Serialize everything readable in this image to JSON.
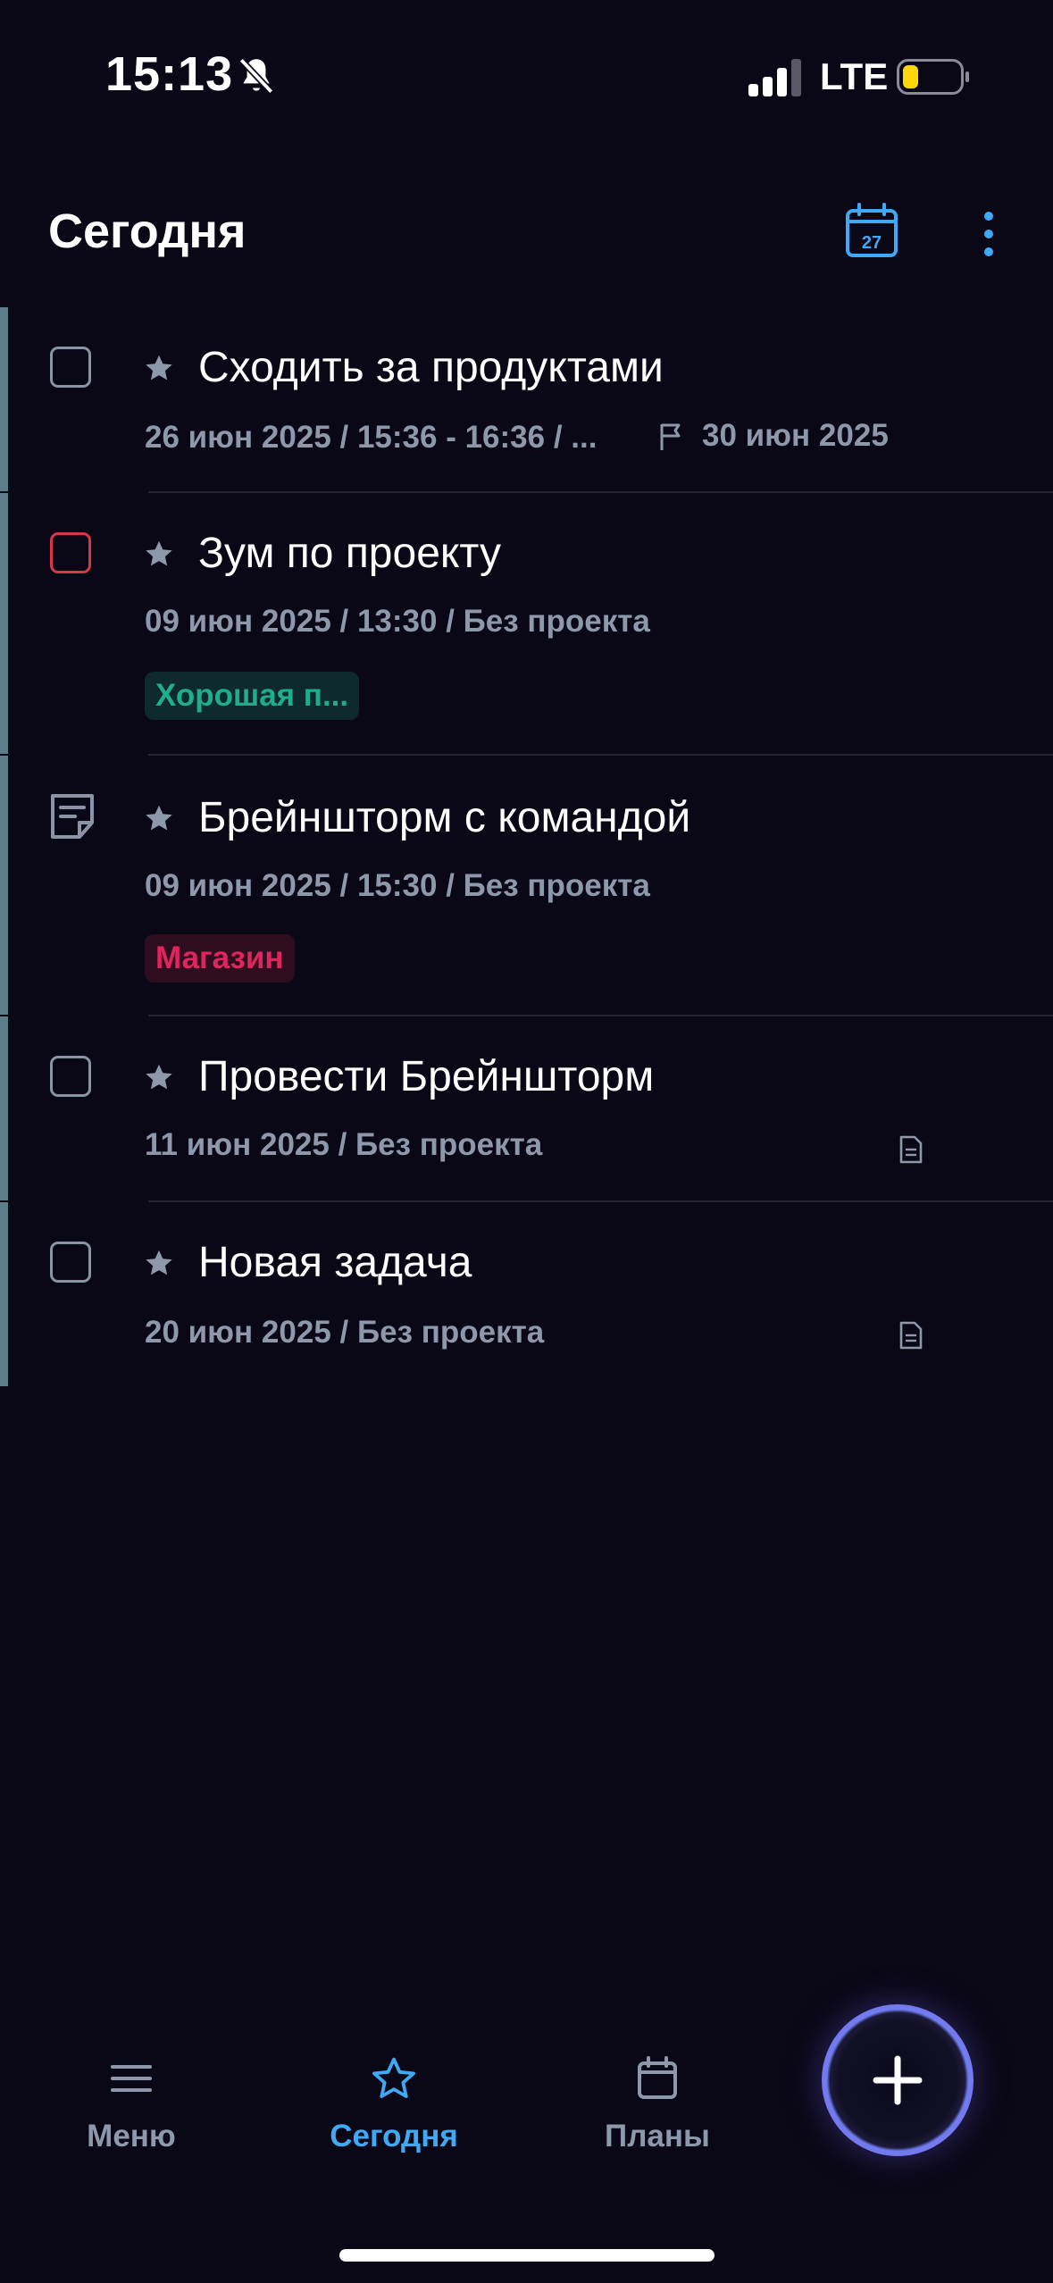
{
  "status_bar": {
    "time": "15:13",
    "network": "LTE"
  },
  "header": {
    "title": "Сегодня",
    "calendar_day": "27"
  },
  "tasks": [
    {
      "title": "Сходить за продуктами",
      "meta": "26 июн 2025 / 15:36 - 16:36 / ...",
      "due": "30 июн 2025"
    },
    {
      "title": "Зум по проекту",
      "meta": "09 июн 2025 / 13:30 / Без проекта",
      "tag": "Хорошая п...",
      "tag_color": "#1fae8c",
      "tag_bg": "#0e2a2e"
    },
    {
      "title": "Брейншторм с командой",
      "meta": "09 июн 2025 / 15:30 / Без проекта",
      "tag": "Магазин",
      "tag_color": "#e0245e",
      "tag_bg": "#2e0d1e"
    },
    {
      "title": "Провести Брейншторм",
      "meta": "11 июн 2025 / Без проекта"
    },
    {
      "title": "Новая задача",
      "meta": "20 июн 2025 / Без проекта"
    }
  ],
  "nav": {
    "menu": "Меню",
    "today": "Сегодня",
    "plans": "Планы"
  },
  "colors": {
    "accent": "#3fa9f5",
    "background": "#0a0716",
    "muted": "#8d99ab",
    "overdue": "#d9364a"
  }
}
